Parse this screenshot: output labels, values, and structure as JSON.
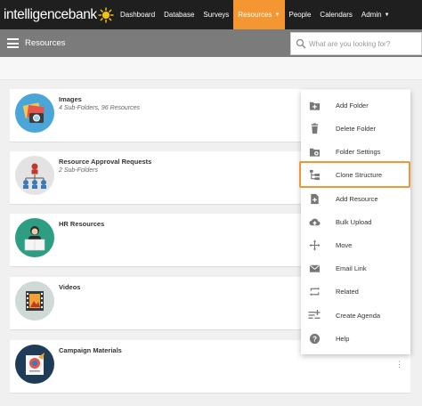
{
  "brand": {
    "name": "intelligencebank"
  },
  "nav": {
    "items": [
      {
        "label": "Dashboard"
      },
      {
        "label": "Database"
      },
      {
        "label": "Surveys"
      },
      {
        "label": "Resources"
      },
      {
        "label": "People"
      },
      {
        "label": "Calendars"
      },
      {
        "label": "Admin"
      }
    ]
  },
  "subbar": {
    "title": "Resources",
    "search_placeholder": "What are you looking for?"
  },
  "cards": [
    {
      "title": "Images",
      "subtitle": "4 Sub-Folders, 96 Resources"
    },
    {
      "title": "Resource Approval Requests",
      "subtitle": "2 Sub-Folders"
    },
    {
      "title": "HR Resources",
      "subtitle": ""
    },
    {
      "title": "Videos",
      "subtitle": ""
    },
    {
      "title": "Campaign Materials",
      "subtitle": ""
    }
  ],
  "dropdown": {
    "items": [
      {
        "label": "Add Folder",
        "icon": "add-folder-icon"
      },
      {
        "label": "Delete Folder",
        "icon": "trash-icon"
      },
      {
        "label": "Folder Settings",
        "icon": "folder-settings-icon"
      },
      {
        "label": "Clone Structure",
        "icon": "clone-structure-icon"
      },
      {
        "label": "Add Resource",
        "icon": "add-resource-icon"
      },
      {
        "label": "Bulk Upload",
        "icon": "cloud-upload-icon"
      },
      {
        "label": "Move",
        "icon": "move-arrows-icon"
      },
      {
        "label": "Email Link",
        "icon": "envelope-icon"
      },
      {
        "label": "Related",
        "icon": "related-arrows-icon"
      },
      {
        "label": "Create Agenda",
        "icon": "agenda-list-icon"
      },
      {
        "label": "Help",
        "icon": "help-icon"
      }
    ],
    "highlighted": "Clone Structure"
  },
  "colors": {
    "accent": "#f49632",
    "nav_bg": "#1f1f1f",
    "subbar_bg": "#7b7b7b"
  }
}
